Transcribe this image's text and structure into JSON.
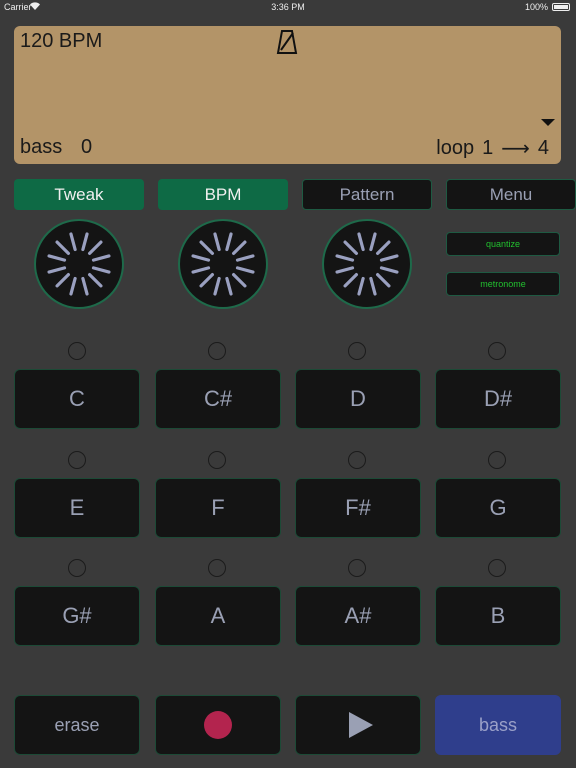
{
  "status_bar": {
    "carrier": "Carrier",
    "time": "3:36 PM",
    "battery": "100%"
  },
  "display": {
    "bpm": "120 BPM",
    "instrument": "bass",
    "instrument_number": "0",
    "loop_label": "loop",
    "loop_start": "1",
    "loop_arrow": "⟶",
    "loop_end": "4",
    "background": "#b39468"
  },
  "top_buttons": [
    {
      "label": "Tweak",
      "active": true
    },
    {
      "label": "BPM",
      "active": true
    },
    {
      "label": "Pattern",
      "active": false
    },
    {
      "label": "Menu",
      "active": false
    }
  ],
  "side_buttons": {
    "quantize": "quantize",
    "metronome": "metronome"
  },
  "pads": [
    "C",
    "C#",
    "D",
    "D#",
    "E",
    "F",
    "F#",
    "G",
    "G#",
    "A",
    "A#",
    "B"
  ],
  "controls": {
    "erase": "erase",
    "record_icon": "record-icon",
    "play_icon": "play-icon",
    "instrument": "bass"
  },
  "colors": {
    "active_green": "#0e6a45",
    "accent_text_green": "#22c02f",
    "record_red": "#b3244e",
    "instrument_blue": "#2f3e8c"
  }
}
